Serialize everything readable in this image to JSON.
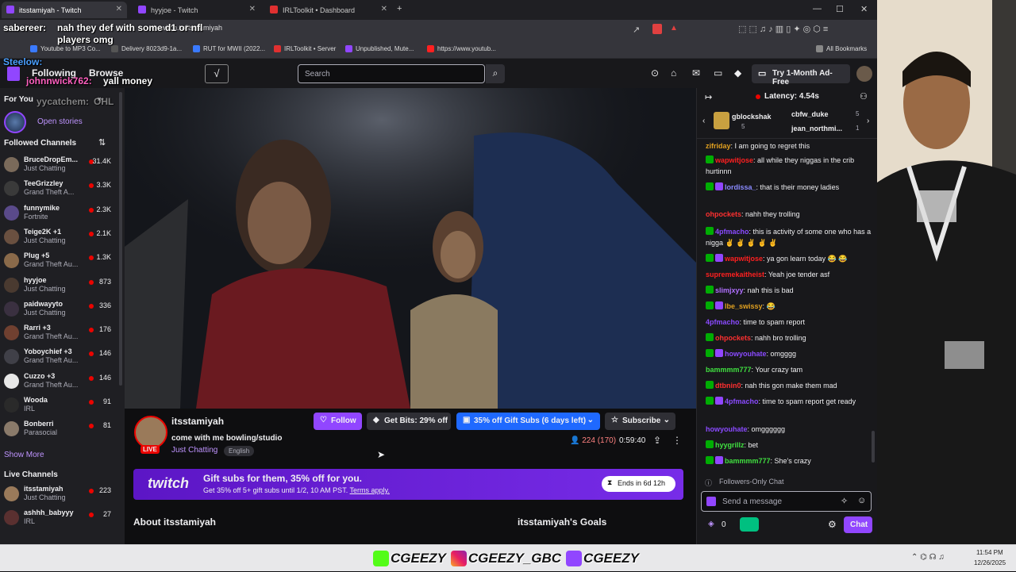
{
  "browser": {
    "tabs": [
      {
        "label": "itsstamiyah - Twitch",
        "active": true
      },
      {
        "label": "hyyjoe - Twitch",
        "active": false
      },
      {
        "label": "IRLToolkit • Dashboard",
        "active": false
      }
    ],
    "url": "twitch.tv/itsstamiyah",
    "bookmarks": [
      "Youtube to MP3 Co...",
      "Delivery 8023d9-1a...",
      "RUT for MWII (2022...",
      "IRLToolkit • Server",
      "Unpublished, Mute...",
      "https://www.youtub..."
    ],
    "all_bookmarks": "All Bookmarks"
  },
  "topnav": {
    "following": "Following",
    "browse": "Browse",
    "search_placeholder": "Search",
    "adfree": "Try 1-Month Ad-Free"
  },
  "sidebar": {
    "for_you": "For You",
    "open_stories": "Open stories",
    "followed_title": "Followed Channels",
    "followed": [
      {
        "name": "BruceDropEm...",
        "game": "Just Chatting",
        "viewers": "31.4K",
        "color": "#7a6a5a"
      },
      {
        "name": "TeeGrizzley",
        "game": "Grand Theft A...",
        "viewers": "3.3K",
        "color": "#3a3a3a"
      },
      {
        "name": "funnymike",
        "game": "Fortnite",
        "viewers": "2.3K",
        "color": "#5a4a8a"
      },
      {
        "name": "Teige2K +1",
        "game": "Just Chatting",
        "viewers": "2.1K",
        "color": "#6a5040"
      },
      {
        "name": "Plug +5",
        "game": "Grand Theft Au...",
        "viewers": "1.3K",
        "color": "#8a6a4a"
      },
      {
        "name": "hyyjoe",
        "game": "Just Chatting",
        "viewers": "873",
        "color": "#4a3a30"
      },
      {
        "name": "paidwayyto",
        "game": "Just Chatting",
        "viewers": "336",
        "color": "#3a3040"
      },
      {
        "name": "Rarri +3",
        "game": "Grand Theft Au...",
        "viewers": "176",
        "color": "#704030"
      },
      {
        "name": "Yoboychief +3",
        "game": "Grand Theft Au...",
        "viewers": "146",
        "color": "#404048"
      },
      {
        "name": "Cuzzo +3",
        "game": "Grand Theft Au...",
        "viewers": "146",
        "color": "#e8e8e8"
      },
      {
        "name": "Wooda",
        "game": "IRL",
        "viewers": "91",
        "color": "#2a2a2a"
      },
      {
        "name": "Bonberri",
        "game": "Parasocial",
        "viewers": "81",
        "color": "#8a7a6a"
      }
    ],
    "show_more": "Show More",
    "live_title": "Live Channels",
    "live": [
      {
        "name": "itsstamiyah",
        "game": "Just Chatting",
        "viewers": "223",
        "color": "#9a7a5a"
      },
      {
        "name": "ashhh_babyyy",
        "game": "IRL",
        "viewers": "27",
        "color": "#5a3030"
      }
    ]
  },
  "stream": {
    "channel": "itsstamiyah",
    "title": "come with me bowling/studio",
    "category": "Just Chatting",
    "tag": "English",
    "live_label": "LIVE",
    "follow": "Follow",
    "bits": "Get Bits: 29% off",
    "gift": "35% off Gift Subs (6 days left)",
    "subscribe": "Subscribe",
    "viewers": "224 (170)",
    "uptime": "0:59:40",
    "banner_logo": "twitch",
    "banner_title": "Gift subs for them, 35% off for you.",
    "banner_sub": "Get 35% off 5+ gift subs until 1/2, 10 AM PST.",
    "banner_terms": "Terms apply.",
    "banner_ends": "Ends in 6d 12h",
    "about": "About itsstamiyah",
    "goals": "itsstamiyah's Goals"
  },
  "chat": {
    "latency": "Latency: 4.54s",
    "gifters": [
      {
        "name": "gblockshak",
        "count": "5"
      },
      {
        "name": "cbfw_duke",
        "count": "5"
      },
      {
        "name": "jean_northmi...",
        "count": "1"
      }
    ],
    "messages": [
      {
        "user": "zifriday",
        "text": "I am going to regret this",
        "color": "#e0a020"
      },
      {
        "user": "wapwitjose",
        "text": "all while they niggas in the crib hurtinnn",
        "color": "#ff2020"
      },
      {
        "user": "lordissa_",
        "text": "that is their money ladies",
        "color": "#8a8aff"
      },
      {
        "user": "ohpockets",
        "text": "nahh they trolling",
        "color": "#ff3030"
      },
      {
        "user": "4pfmacho",
        "text": "this is activity of some one who has a nigga ✌ ✌ ✌ ✌ ✌",
        "color": "#8a4aff"
      },
      {
        "user": "wapwitjose",
        "text": "ya gon learn today 😂 😂",
        "color": "#ff2020"
      },
      {
        "user": "supremekaitheist",
        "text": "Yeah joe tender asf",
        "color": "#ff2020"
      },
      {
        "user": "slimjxyy",
        "text": "nah this is bad",
        "color": "#b070ff"
      },
      {
        "user": "lbe_swissy",
        "text": "😂",
        "color": "#e0a020"
      },
      {
        "user": "4pfmacho",
        "text": "time to spam report",
        "color": "#8a4aff"
      },
      {
        "user": "ohpockets",
        "text": "nahh bro trolling",
        "color": "#ff3030"
      },
      {
        "user": "howyouhate",
        "text": "omgggg",
        "color": "#8a4aff"
      },
      {
        "user": "bammmm777",
        "text": "Your crazy tam",
        "color": "#40e040"
      },
      {
        "user": "dtbnin0",
        "text": "nah this gon make them mad",
        "color": "#ff3030"
      },
      {
        "user": "4pfmacho",
        "text": "time to spam report get ready",
        "color": "#8a4aff"
      },
      {
        "user": "howyouhate",
        "text": "omgggggg",
        "color": "#8a4aff"
      },
      {
        "user": "hyygrillz",
        "text": "bet",
        "color": "#40e040"
      },
      {
        "user": "bammmm777",
        "text": "She's crazy",
        "color": "#40e040"
      }
    ],
    "followers_only": "Followers-Only Chat",
    "placeholder": "Send a message",
    "points": "0",
    "chat_button": "Chat"
  },
  "overlay": {
    "chat_lines": [
      {
        "user": "sabereer:",
        "text": "nah they def with some d1 or nfl players omg",
        "color": "#ffffff"
      },
      {
        "user": "Steelow:",
        "text": "",
        "color": "#4aa0ff"
      },
      {
        "user": "johnnwick762:",
        "text": "yall money",
        "color": "#ff60c0"
      },
      {
        "user": "yycatchem:",
        "text": "OHL",
        "color": "#aaaaaa"
      }
    ],
    "socials": [
      "CGEEZY",
      "CGEEZY_GBC",
      "CGEEZY"
    ]
  },
  "taskbar": {
    "time": "11:54 PM",
    "date": "12/26/2025"
  }
}
